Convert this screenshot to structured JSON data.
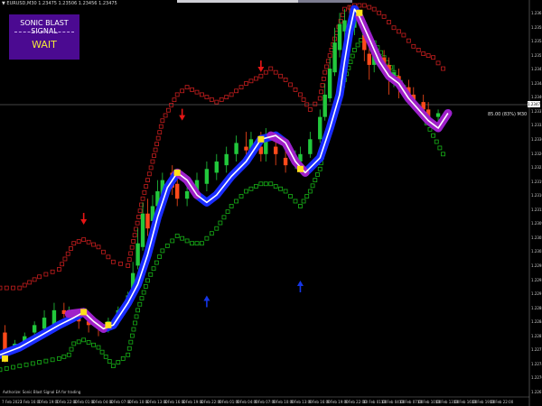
{
  "window": {
    "symbol_info": "▼ EURUSD,M30  1.23475 1.23506 1.23456 1.23475"
  },
  "signal_panel": {
    "title": "SONIC BLAST SIGNAL",
    "status": "WAIT"
  },
  "annotation": {
    "text": "85.00 (83%) M30"
  },
  "footer": {
    "text": "Authorize: Sonic Blast Signal EA for trading"
  },
  "last_price": "1.23475",
  "price_axis": [
    "1.23615",
    "1.23580",
    "1.23545",
    "1.23510",
    "1.23475",
    "1.23440",
    "1.23405",
    "1.23370",
    "1.23335",
    "1.23300",
    "1.23265",
    "1.23230",
    "1.23195",
    "1.23160",
    "1.23125",
    "1.23090",
    "1.23055",
    "1.23020",
    "1.22985",
    "1.22950",
    "1.22915",
    "1.22880",
    "1.22845",
    "1.22810",
    "1.22775",
    "1.22740",
    "1.22705",
    "1.22670"
  ],
  "time_axis": [
    "7 Feb 2023",
    "7 Feb 16:00",
    "7 Feb 19:00",
    "7 Feb 22:00",
    "8 Feb 01:00",
    "8 Feb 04:00",
    "8 Feb 07:00",
    "8 Feb 10:00",
    "8 Feb 13:00",
    "8 Feb 16:00",
    "8 Feb 19:00",
    "8 Feb 22:00",
    "9 Feb 01:00",
    "9 Feb 04:00",
    "9 Feb 07:00",
    "9 Feb 10:00",
    "9 Feb 13:00",
    "9 Feb 16:00",
    "9 Feb 19:00",
    "9 Feb 22:00",
    "10 Feb 01:00",
    "10 Feb 04:00",
    "10 Feb 07:00",
    "10 Feb 10:00",
    "10 Feb 13:00",
    "10 Feb 16:00",
    "10 Feb 19:00",
    "10 Feb 22:00"
  ],
  "colors": {
    "background": "#000000",
    "bull_candle": "#22c83c",
    "bear_candle": "#ff4a1a",
    "upper_band": "#c81e1e",
    "lower_band": "#18b418",
    "trend_line_up": "#1a2dff",
    "trend_line_down": "#a020c8",
    "center_line": "#ffffff",
    "signal_marker": "#ffe01a",
    "sell_arrow": "#e61515",
    "buy_arrow": "#1535e6"
  },
  "chart_data": {
    "type": "candlestick",
    "y_range": [
      0,
      100
    ],
    "x_range": [
      0,
      100
    ],
    "center_line": [
      [
        0,
        6
      ],
      [
        4,
        8
      ],
      [
        8,
        11
      ],
      [
        12,
        14
      ],
      [
        15,
        16
      ],
      [
        17,
        17.5
      ],
      [
        19,
        15
      ],
      [
        21,
        13
      ],
      [
        23,
        14
      ],
      [
        26,
        20
      ],
      [
        28,
        25
      ],
      [
        30,
        33
      ],
      [
        32,
        43
      ],
      [
        34,
        51
      ],
      [
        36,
        55
      ],
      [
        38,
        53
      ],
      [
        40,
        49
      ],
      [
        42,
        47
      ],
      [
        44,
        49
      ],
      [
        47,
        54
      ],
      [
        50,
        58
      ],
      [
        53,
        64
      ],
      [
        56,
        65
      ],
      [
        58,
        63
      ],
      [
        60,
        58
      ],
      [
        62,
        55
      ],
      [
        65,
        59
      ],
      [
        67,
        67
      ],
      [
        69,
        76
      ],
      [
        70,
        85
      ],
      [
        71,
        93
      ],
      [
        72,
        99
      ],
      [
        73,
        97
      ],
      [
        75,
        91
      ],
      [
        77,
        85
      ],
      [
        79,
        81
      ],
      [
        81,
        79
      ],
      [
        83,
        75
      ],
      [
        85,
        72
      ],
      [
        87,
        69
      ],
      [
        89,
        67
      ],
      [
        91,
        71
      ]
    ],
    "downtrend_segments": [
      [
        [
          14,
          17
        ],
        [
          17,
          17.5
        ],
        [
          19,
          15
        ],
        [
          21,
          13
        ]
      ],
      [
        [
          36,
          55
        ],
        [
          38,
          53
        ],
        [
          40,
          49
        ]
      ],
      [
        [
          55,
          65
        ],
        [
          58,
          63
        ],
        [
          60,
          58
        ],
        [
          62,
          55
        ]
      ],
      [
        [
          73,
          97
        ],
        [
          75,
          91
        ],
        [
          77,
          85
        ],
        [
          79,
          81
        ],
        [
          81,
          79
        ],
        [
          83,
          75
        ],
        [
          85,
          72
        ],
        [
          87,
          69
        ],
        [
          89,
          67
        ],
        [
          91,
          71
        ]
      ]
    ],
    "upper_band": [
      [
        0,
        24
      ],
      [
        4,
        24
      ],
      [
        8,
        27
      ],
      [
        12,
        29
      ],
      [
        15,
        36
      ],
      [
        17,
        37
      ],
      [
        20,
        35
      ],
      [
        23,
        31
      ],
      [
        26,
        30
      ],
      [
        29,
        48
      ],
      [
        31,
        58
      ],
      [
        33,
        69
      ],
      [
        36,
        76
      ],
      [
        38,
        78
      ],
      [
        41,
        76
      ],
      [
        44,
        74
      ],
      [
        47,
        76
      ],
      [
        50,
        79
      ],
      [
        53,
        81
      ],
      [
        55,
        83
      ],
      [
        58,
        80
      ],
      [
        61,
        76
      ],
      [
        63,
        72
      ],
      [
        65,
        75
      ],
      [
        66,
        82
      ],
      [
        68,
        91
      ],
      [
        70,
        99
      ],
      [
        72,
        100
      ],
      [
        74,
        100
      ],
      [
        76,
        99
      ],
      [
        78,
        97
      ],
      [
        80,
        94
      ],
      [
        82,
        92
      ],
      [
        84,
        89
      ],
      [
        86,
        87
      ],
      [
        88,
        86
      ],
      [
        90,
        83
      ]
    ],
    "lower_band": [
      [
        0,
        2
      ],
      [
        4,
        3
      ],
      [
        8,
        4
      ],
      [
        12,
        5
      ],
      [
        14,
        6
      ],
      [
        15,
        9
      ],
      [
        17,
        10
      ],
      [
        20,
        8
      ],
      [
        23,
        3
      ],
      [
        26,
        6
      ],
      [
        28,
        18
      ],
      [
        30,
        26
      ],
      [
        33,
        34
      ],
      [
        36,
        38
      ],
      [
        39,
        36
      ],
      [
        41,
        36
      ],
      [
        44,
        40
      ],
      [
        47,
        46
      ],
      [
        50,
        50
      ],
      [
        53,
        52
      ],
      [
        55,
        52
      ],
      [
        58,
        50
      ],
      [
        61,
        46
      ],
      [
        63,
        50
      ],
      [
        65,
        56
      ],
      [
        66,
        64
      ],
      [
        68,
        71
      ],
      [
        70,
        80
      ],
      [
        72,
        88
      ],
      [
        74,
        92
      ],
      [
        76,
        90
      ],
      [
        78,
        86
      ],
      [
        80,
        82
      ],
      [
        82,
        78
      ],
      [
        84,
        74
      ],
      [
        86,
        70
      ],
      [
        88,
        65
      ],
      [
        90,
        60
      ]
    ],
    "candles": [
      [
        1,
        12,
        5,
        14,
        4
      ],
      [
        3,
        8,
        9,
        10,
        7
      ],
      [
        5,
        9,
        11,
        12,
        8
      ],
      [
        7,
        12,
        14,
        15,
        11
      ],
      [
        9,
        13,
        16,
        18,
        12
      ],
      [
        11,
        14,
        18,
        20,
        13
      ],
      [
        13,
        18,
        17,
        20,
        16
      ],
      [
        14,
        17,
        18,
        19,
        15
      ],
      [
        16,
        17,
        15,
        18,
        13
      ],
      [
        18,
        15,
        14,
        16,
        12
      ],
      [
        20,
        14,
        13,
        15,
        11
      ],
      [
        22,
        13,
        15,
        16,
        12
      ],
      [
        24,
        15,
        18,
        19,
        14
      ],
      [
        26,
        20,
        22,
        23,
        19
      ],
      [
        27,
        22,
        28,
        31,
        21
      ],
      [
        28,
        30,
        36,
        40,
        29
      ],
      [
        29,
        35,
        44,
        47,
        34
      ],
      [
        30,
        44,
        40,
        48,
        38
      ],
      [
        31,
        42,
        46,
        49,
        40
      ],
      [
        32,
        46,
        50,
        53,
        44
      ],
      [
        33,
        48,
        53,
        55,
        46
      ],
      [
        35,
        55,
        51,
        57,
        49
      ],
      [
        36,
        52,
        48,
        54,
        46
      ],
      [
        38,
        48,
        50,
        52,
        46
      ],
      [
        40,
        50,
        53,
        55,
        48
      ],
      [
        42,
        52,
        56,
        58,
        50
      ],
      [
        44,
        55,
        58,
        60,
        53
      ],
      [
        46,
        57,
        60,
        62,
        55
      ],
      [
        48,
        60,
        63,
        65,
        58
      ],
      [
        50,
        62,
        61,
        66,
        59
      ],
      [
        51,
        61,
        64,
        66,
        59
      ],
      [
        53,
        62,
        60,
        66,
        58
      ],
      [
        54,
        60,
        64,
        67,
        58
      ],
      [
        56,
        62,
        60,
        64,
        57
      ],
      [
        58,
        59,
        57,
        61,
        55
      ],
      [
        60,
        57,
        59,
        61,
        56
      ],
      [
        61,
        58,
        60,
        62,
        57
      ],
      [
        63,
        60,
        64,
        66,
        59
      ],
      [
        65,
        64,
        70,
        72,
        63
      ],
      [
        66,
        70,
        76,
        79,
        69
      ],
      [
        67,
        75,
        83,
        86,
        74
      ],
      [
        68,
        82,
        90,
        94,
        81
      ],
      [
        69,
        88,
        95,
        98,
        86
      ],
      [
        70,
        93,
        96,
        99,
        91
      ],
      [
        71,
        96,
        92,
        100,
        90
      ],
      [
        72,
        94,
        98,
        100,
        92
      ],
      [
        74,
        92,
        88,
        95,
        85
      ],
      [
        75,
        87,
        84,
        90,
        80
      ],
      [
        76,
        84,
        87,
        89,
        82
      ],
      [
        78,
        86,
        84,
        88,
        82
      ],
      [
        79,
        84,
        80,
        86,
        76
      ],
      [
        80,
        80,
        82,
        84,
        78
      ],
      [
        81,
        81,
        78,
        83,
        75
      ],
      [
        83,
        78,
        76,
        80,
        74
      ],
      [
        84,
        76,
        74,
        78,
        72
      ],
      [
        86,
        74,
        72,
        76,
        70
      ],
      [
        87,
        72,
        70,
        74,
        68
      ],
      [
        89,
        70,
        71,
        72,
        68
      ]
    ],
    "signal_markers": [
      [
        1,
        5
      ],
      [
        17,
        17.5
      ],
      [
        22,
        14
      ],
      [
        36,
        55
      ],
      [
        53,
        64
      ],
      [
        61,
        56
      ],
      [
        73,
        98
      ]
    ],
    "sell_arrows": [
      [
        17,
        42
      ],
      [
        37,
        70
      ],
      [
        53,
        83
      ]
    ],
    "buy_arrows": [
      [
        42,
        21
      ],
      [
        61,
        25
      ]
    ]
  }
}
